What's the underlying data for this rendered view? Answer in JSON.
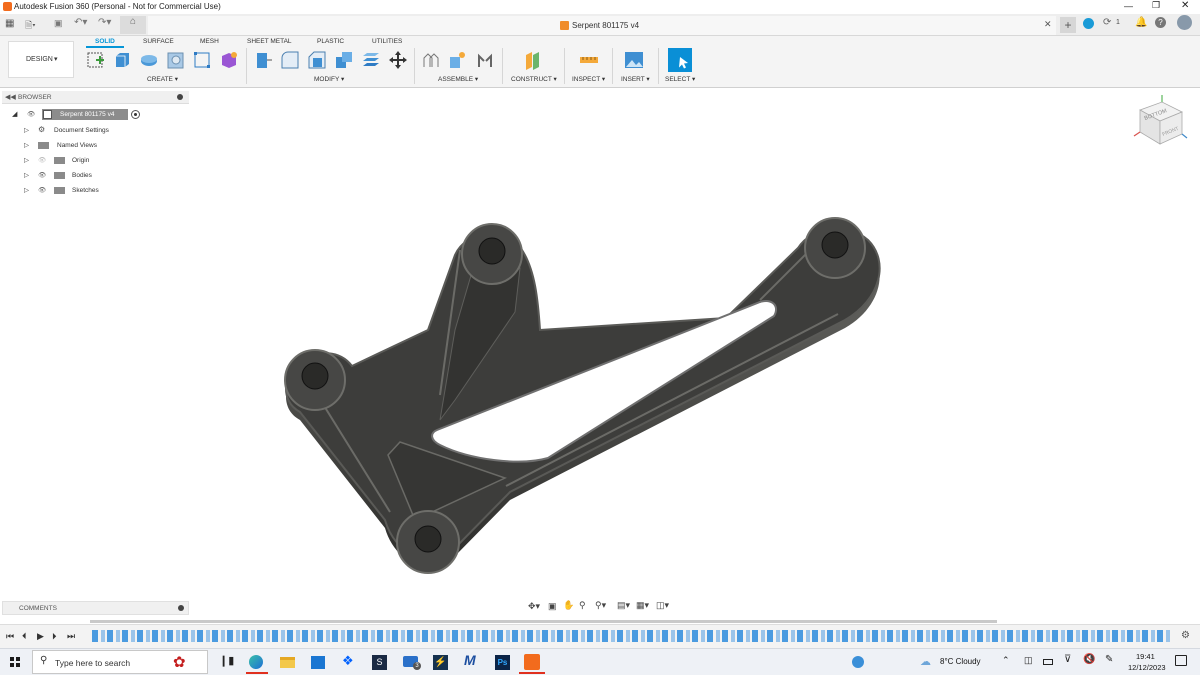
{
  "window": {
    "title": "Autodesk Fusion 360 (Personal - Not for Commercial Use)",
    "document_tab": "Serpent 801175 v4",
    "notification_count": "1"
  },
  "toolbar": {
    "workspace": "DESIGN",
    "tabs": [
      "SOLID",
      "SURFACE",
      "MESH",
      "SHEET METAL",
      "PLASTIC",
      "UTILITIES"
    ],
    "groups": [
      "CREATE",
      "MODIFY",
      "ASSEMBLE",
      "CONSTRUCT",
      "INSPECT",
      "INSERT",
      "SELECT"
    ]
  },
  "browser": {
    "title": "BROWSER",
    "root": "Serpent 801175 v4",
    "items": [
      "Document Settings",
      "Named Views",
      "Origin",
      "Bodies",
      "Sketches"
    ]
  },
  "comments": {
    "title": "COMMENTS"
  },
  "viewcube": {
    "top": "BOTTOM",
    "front": "FRONT"
  },
  "taskbar": {
    "search_placeholder": "Type here to search",
    "weather": "8°C  Cloudy",
    "time": "19:41",
    "date": "12/12/2023"
  },
  "colors": {
    "accent": "#0696d7",
    "part": "#3b3b39",
    "taskbar": "#eef1f6"
  }
}
